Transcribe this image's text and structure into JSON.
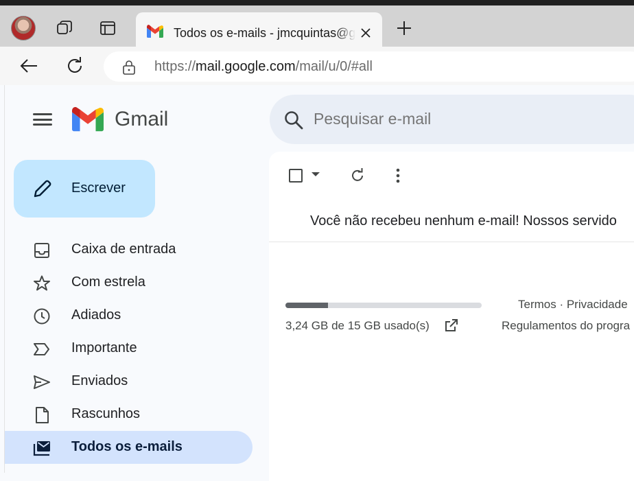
{
  "browser": {
    "tab_title": "Todos os e-mails - jmcquintas@gmail.com - Gmail",
    "url_prefix": "https://",
    "url_host": "mail.google.com",
    "url_path": "/mail/u/0/#all"
  },
  "gmail": {
    "product_name": "Gmail",
    "search_placeholder": "Pesquisar e-mail",
    "compose_label": "Escrever"
  },
  "sidebar": {
    "items": [
      {
        "label": "Caixa de entrada",
        "icon": "inbox-icon"
      },
      {
        "label": "Com estrela",
        "icon": "star-icon"
      },
      {
        "label": "Adiados",
        "icon": "clock-icon"
      },
      {
        "label": "Importante",
        "icon": "important-icon"
      },
      {
        "label": "Enviados",
        "icon": "send-icon"
      },
      {
        "label": "Rascunhos",
        "icon": "draft-icon"
      },
      {
        "label": "Todos os e-mails",
        "icon": "all-mail-icon",
        "active": true
      }
    ]
  },
  "main": {
    "empty_message": "Você não recebeu nenhum e-mail! Nossos servido",
    "storage_text": "3,24 GB de 15 GB usado(s)",
    "storage_used_fraction": 0.216,
    "footer_line1": "Termos · Privacidade",
    "footer_line2": "Regulamentos do progra"
  },
  "colors": {
    "compose_bg": "#c2e7ff",
    "active_nav_bg": "#d3e3fd",
    "search_bg": "#e9eef6"
  }
}
